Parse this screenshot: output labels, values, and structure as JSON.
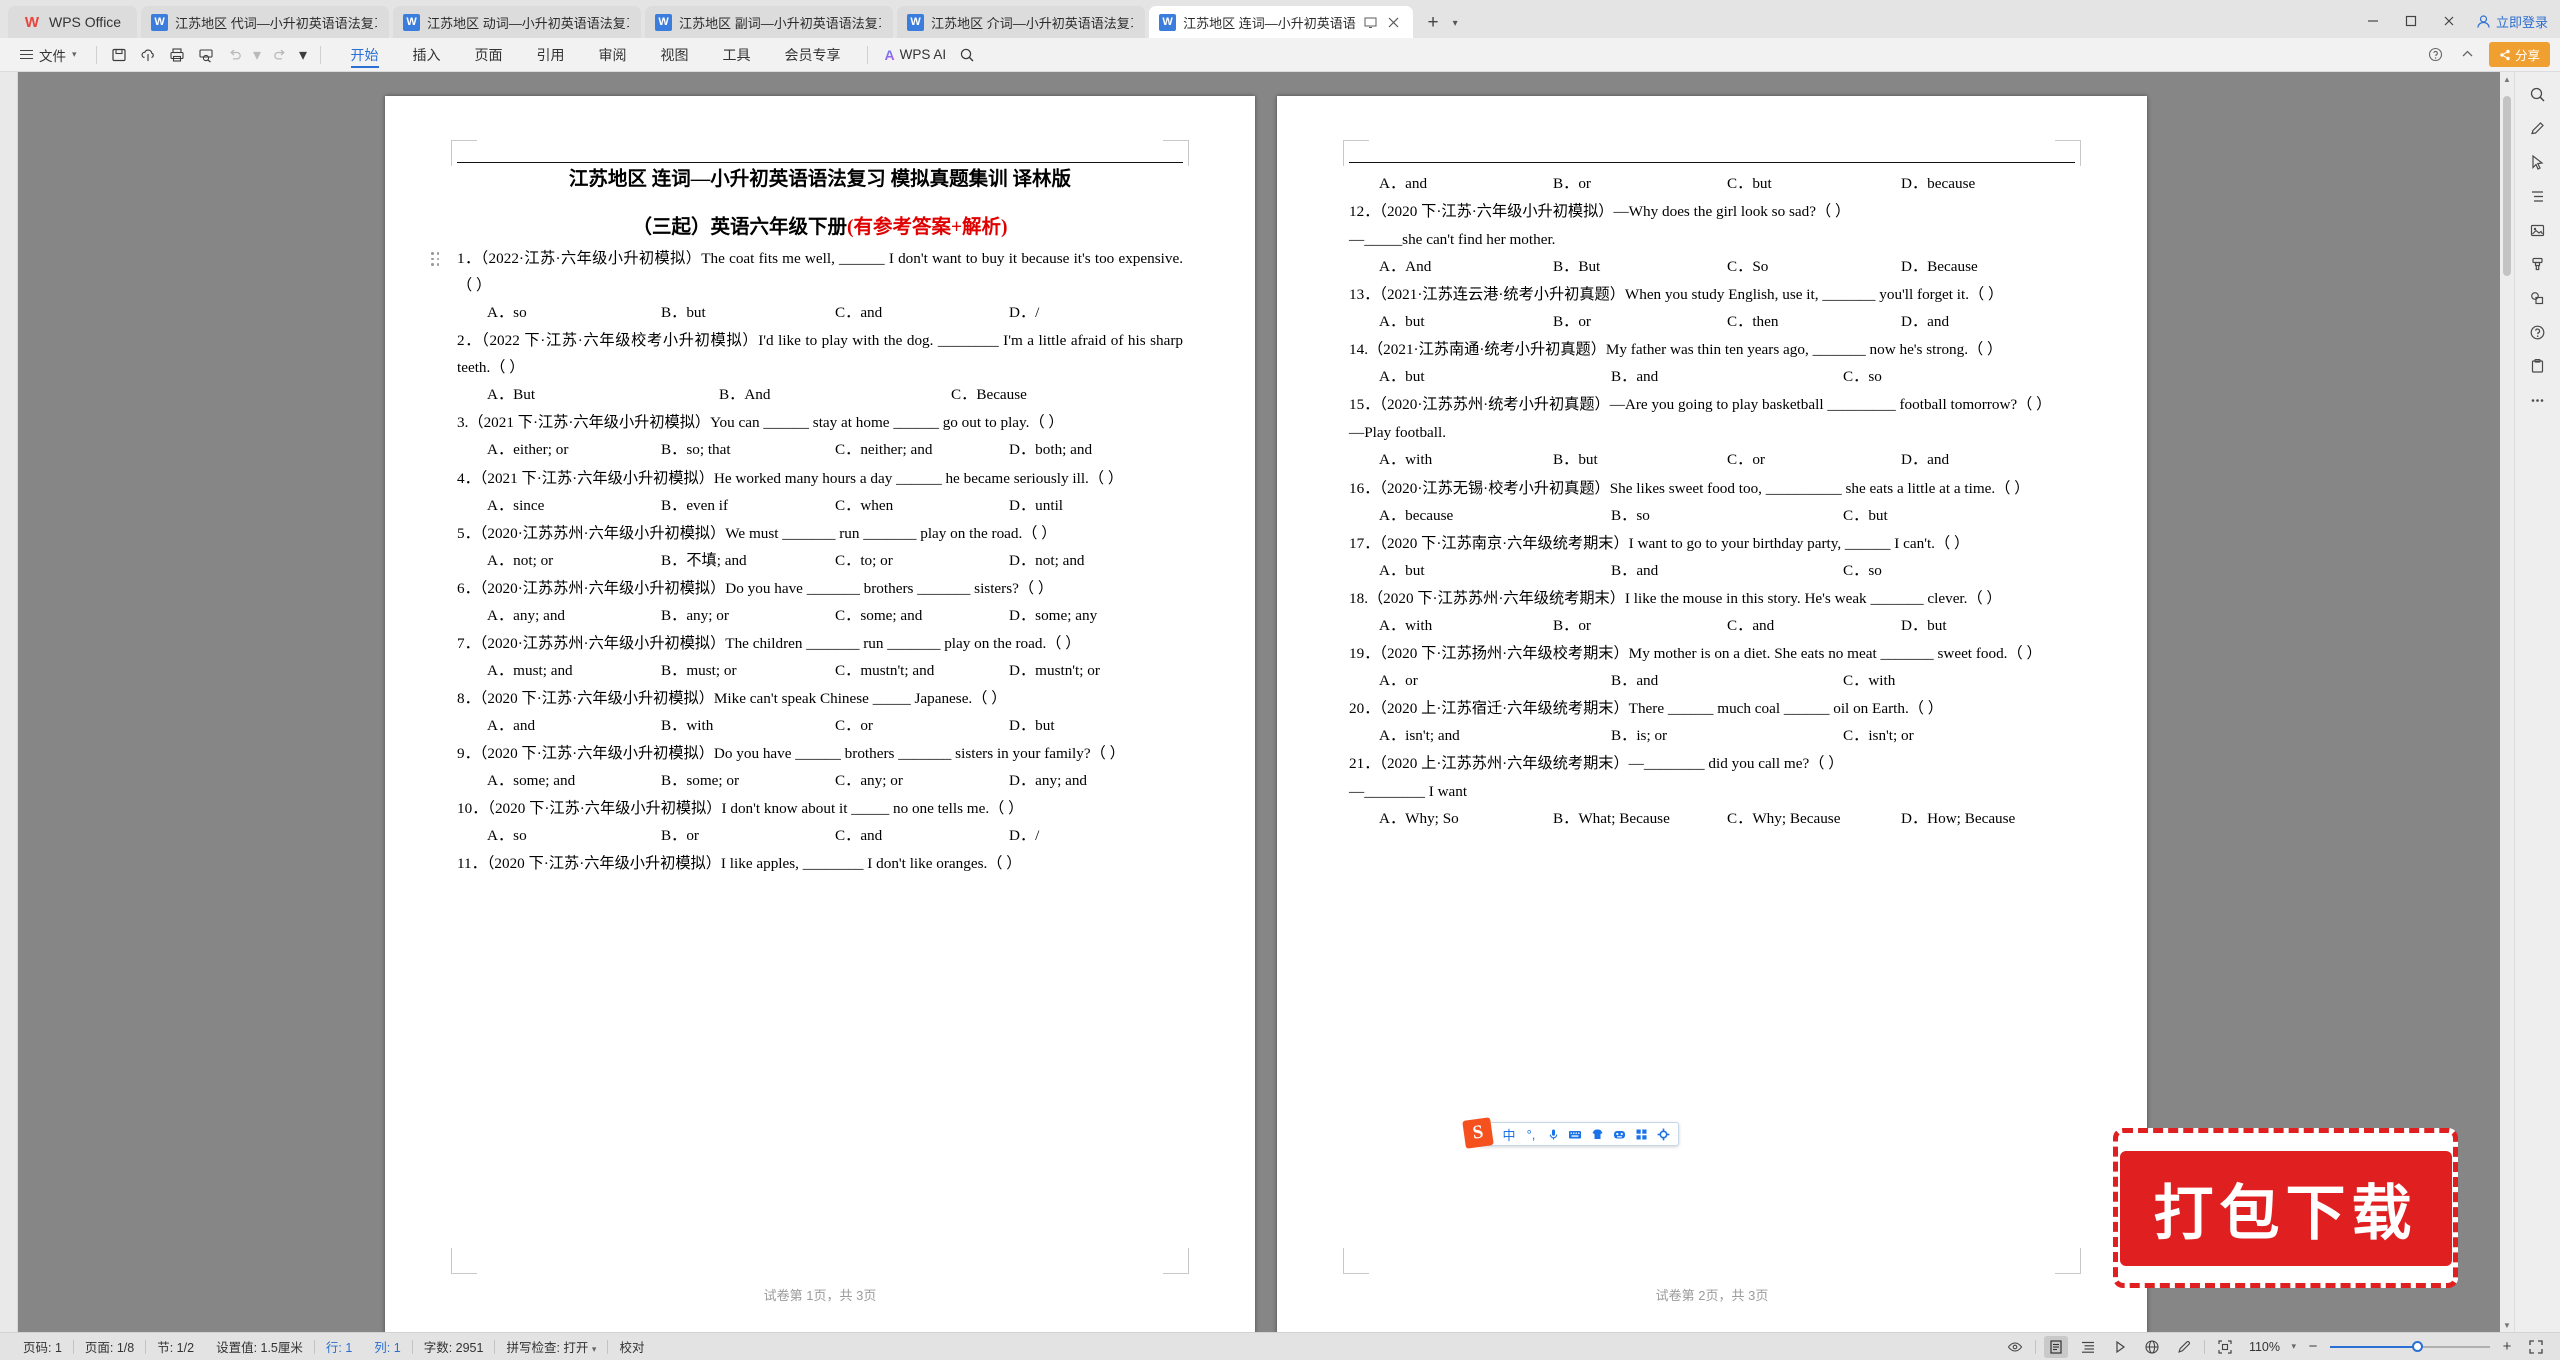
{
  "window": {
    "brand": "WPS Office",
    "login_label": "立即登录",
    "share_label": "分享"
  },
  "tabs": [
    {
      "label": "江苏地区 代词—小升初英语语法复习",
      "active": false
    },
    {
      "label": "江苏地区 动词—小升初英语语法复习",
      "active": false
    },
    {
      "label": "江苏地区 副词—小升初英语语法复习",
      "active": false
    },
    {
      "label": "江苏地区 介词—小升初英语语法复习",
      "active": false
    },
    {
      "label": "江苏地区 连词—小升初英语语…",
      "active": true
    }
  ],
  "ribbon": {
    "file_label": "文件",
    "tabs": [
      {
        "label": "开始",
        "active": true
      },
      {
        "label": "插入",
        "active": false
      },
      {
        "label": "页面",
        "active": false
      },
      {
        "label": "引用",
        "active": false
      },
      {
        "label": "审阅",
        "active": false
      },
      {
        "label": "视图",
        "active": false
      },
      {
        "label": "工具",
        "active": false
      },
      {
        "label": "会员专享",
        "active": false
      }
    ],
    "ai_label": "WPS AI"
  },
  "document": {
    "title_line1": "江苏地区 连词—小升初英语语法复习 模拟真题集训 译林版",
    "title_line2_black": "（三起）英语六年级下册",
    "title_line2_red": "(有参考答案+解析)",
    "page1_footer": "试卷第 1页，共 3页",
    "page2_footer": "试卷第 2页，共 3页",
    "page1_items": [
      {
        "type": "q",
        "text": "1．（2022·江苏·六年级小升初模拟）The coat fits me well, ______ I don't want to buy it because it's too expensive.（  ）"
      },
      {
        "type": "opts",
        "cols": [
          "A．so",
          "B．but",
          "C．and",
          "D．/"
        ]
      },
      {
        "type": "q",
        "text": "2．（2022 下·江苏·六年级校考小升初模拟）I'd like to play with the dog. ________ I'm a little afraid of his sharp teeth.（   ）"
      },
      {
        "type": "opts3",
        "cols": [
          "A．But",
          "B．And",
          "C．Because"
        ]
      },
      {
        "type": "q",
        "text": "3.（2021 下·江苏·六年级小升初模拟）You can ______ stay at home ______ go out to play.（ ）"
      },
      {
        "type": "opts",
        "cols": [
          "A．either; or",
          "B．so; that",
          "C．neither; and",
          "D．both; and"
        ]
      },
      {
        "type": "q",
        "text": "4．（2021 下·江苏·六年级小升初模拟）He worked many hours a day ______ he became seriously ill.（ ）"
      },
      {
        "type": "opts",
        "cols": [
          "A．since",
          "B．even if",
          "C．when",
          "D．until"
        ]
      },
      {
        "type": "q",
        "text": "5．（2020·江苏苏州·六年级小升初模拟）We must _______ run _______ play on the road.（ ）"
      },
      {
        "type": "opts",
        "cols": [
          "A．not; or",
          "B．不填; and",
          "C．to; or",
          "D．not; and"
        ]
      },
      {
        "type": "q",
        "text": "6．（2020·江苏苏州·六年级小升初模拟）Do you have _______ brothers _______ sisters?（ ）"
      },
      {
        "type": "opts",
        "cols": [
          "A．any; and",
          "B．any; or",
          "C．some; and",
          "D．some; any"
        ]
      },
      {
        "type": "q",
        "text": "7．（2020·江苏苏州·六年级小升初模拟）The children _______ run _______ play on the road.（ ）"
      },
      {
        "type": "opts",
        "cols": [
          "A．must; and",
          "B．must; or",
          "C．mustn't; and",
          "D．mustn't; or"
        ]
      },
      {
        "type": "q",
        "text": "8．（2020 下·江苏·六年级小升初模拟）Mike can't speak Chinese _____ Japanese.（   ）"
      },
      {
        "type": "opts",
        "cols": [
          "A．and",
          "B．with",
          "C．or",
          "D．but"
        ]
      },
      {
        "type": "q",
        "text": "9．（2020 下·江苏·六年级小升初模拟）Do you have ______ brothers _______ sisters in your family?（ ）"
      },
      {
        "type": "opts",
        "cols": [
          "A．some; and",
          "B．some; or",
          "C．any; or",
          "D．any; and"
        ]
      },
      {
        "type": "q",
        "text": "10．（2020 下·江苏·六年级小升初模拟）I don't know about it _____ no one tells me.（ ）"
      },
      {
        "type": "opts",
        "cols": [
          "A．so",
          "B．or",
          "C．and",
          "D．/"
        ]
      },
      {
        "type": "q",
        "text": "11．（2020 下·江苏·六年级小升初模拟）I like apples, ________ I don't like oranges.（   ）"
      }
    ],
    "page2_items": [
      {
        "type": "opts",
        "cols": [
          "A．and",
          "B．or",
          "C．but",
          "D．because"
        ]
      },
      {
        "type": "q",
        "text": "12．（2020 下·江苏·六年级小升初模拟）—Why does the girl look so sad?（   ）"
      },
      {
        "type": "q",
        "text": "—_____she can't find her mother."
      },
      {
        "type": "opts",
        "cols": [
          "A．And",
          "B．But",
          "C．So",
          "D．Because"
        ]
      },
      {
        "type": "q",
        "text": "13．（2021·江苏连云港·统考小升初真题）When you study English, use it, _______ you'll forget it.（ ）"
      },
      {
        "type": "opts",
        "cols": [
          "A．but",
          "B．or",
          "C．then",
          "D．and"
        ]
      },
      {
        "type": "q",
        "text": "14.（2021·江苏南通·统考小升初真题）My father was thin ten years ago, _______ now he's strong.（   ）"
      },
      {
        "type": "opts3",
        "cols": [
          "A．but",
          "B．and",
          "C．so"
        ]
      },
      {
        "type": "q",
        "text": "15．（2020·江苏苏州·统考小升初真题）—Are you going to play basketball _________ football tomorrow?（ ）"
      },
      {
        "type": "q",
        "text": "—Play football."
      },
      {
        "type": "opts",
        "cols": [
          "A．with",
          "B．but",
          "C．or",
          "D．and"
        ]
      },
      {
        "type": "q",
        "text": "16．（2020·江苏无锡·校考小升初真题）She likes sweet food too, __________ she eats a little at a time.（ ）"
      },
      {
        "type": "opts3",
        "cols": [
          "A．because",
          "B．so",
          "C．but"
        ]
      },
      {
        "type": "q",
        "text": "17．（2020 下·江苏南京·六年级统考期末）I want to go to your birthday party, ______ I can't.（ ）"
      },
      {
        "type": "opts3",
        "cols": [
          "A．but",
          "B．and",
          "C．so"
        ]
      },
      {
        "type": "q",
        "text": "18.（2020 下·江苏苏州·六年级统考期末）I like the mouse in this story. He's weak _______ clever.（    ）"
      },
      {
        "type": "opts",
        "cols": [
          "A．with",
          "B．or",
          "C．and",
          "D．but"
        ]
      },
      {
        "type": "q",
        "text": "19．（2020 下·江苏扬州·六年级校考期末）My mother is on a diet. She eats no meat _______ sweet food.（ ）"
      },
      {
        "type": "opts3",
        "cols": [
          "A．or",
          "B．and",
          "C．with"
        ]
      },
      {
        "type": "q",
        "text": "20．（2020 上·江苏宿迁·六年级统考期末）There ______ much coal ______ oil on Earth.（ ）"
      },
      {
        "type": "opts3",
        "cols": [
          "A．isn't; and",
          "B．is; or",
          "C．isn't; or"
        ]
      },
      {
        "type": "q",
        "text": "21．（2020 上·江苏苏州·六年级统考期末）—________ did you call me?（ ）"
      },
      {
        "type": "q",
        "text": "—________ I want"
      },
      {
        "type": "opts",
        "cols": [
          "A．Why; So",
          "B．What; Because",
          "C．Why; Because",
          "D．How; Because"
        ]
      }
    ]
  },
  "ime_toolbar": {
    "logo": "S",
    "items": [
      "中",
      "°,",
      "mic-icon",
      "keyboard-icon",
      "skin-icon",
      "emoji-icon",
      "apps-icon",
      "settings-icon"
    ]
  },
  "download_badge": {
    "label": "打包下载"
  },
  "statusbar": {
    "page_number_label": "页码: 1",
    "page_count_label": "页面: 1/8",
    "section_label": "节: 1/2",
    "setting_label": "设置值: 1.5厘米",
    "row_label": "行: 1",
    "col_label": "列: 1",
    "word_count_label": "字数: 2951",
    "spellcheck_label": "拼写检查: 打开",
    "proofread_label": "校对",
    "zoom_label": "110%"
  }
}
